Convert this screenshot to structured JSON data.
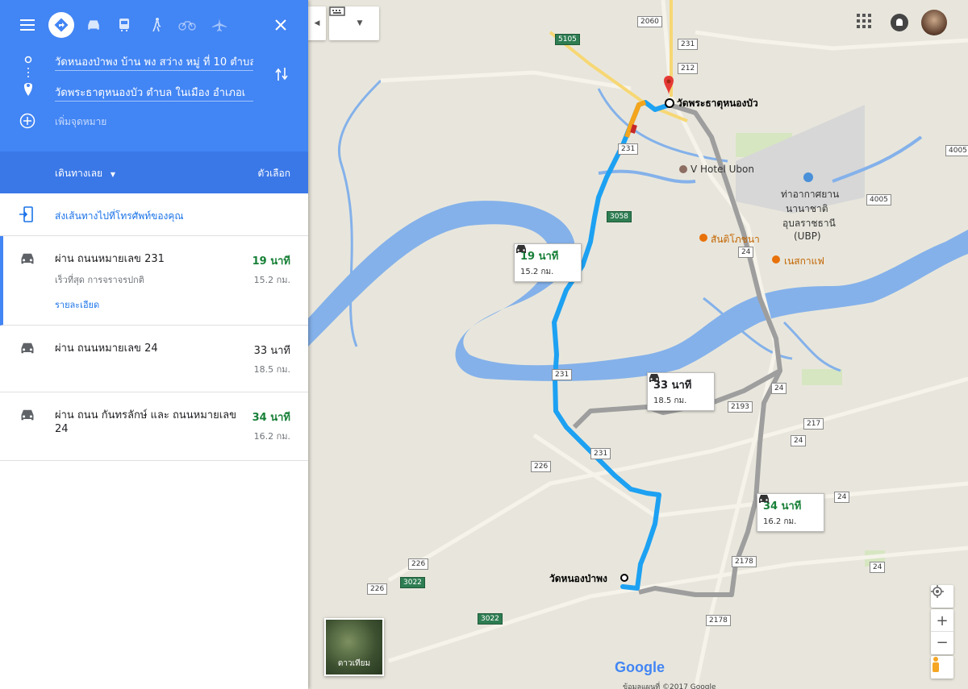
{
  "panel": {
    "origin": "วัดหนองป่าพง บ้าน พง สว่าง หมู่ ที่ 10 ตำบล",
    "destination": "วัดพระธาตุหนองบัว ตำบล ในเมือง อำเภอเ",
    "add_destination": "เพิ่มจุดหมาย",
    "depart_label": "เดินทางเลย",
    "options_label": "ตัวเลือก",
    "send_to_phone": "ส่งเส้นทางไปที่โทรศัพท์ของคุณ"
  },
  "modes": [
    "directions-icon",
    "car-icon",
    "transit-icon",
    "walk-icon",
    "bike-icon",
    "flight-icon"
  ],
  "routes": [
    {
      "via": "ผ่าน ถนนหมายเลข 231",
      "sub": "เร็วที่สุด การจราจรปกติ",
      "details": "รายละเอียด",
      "time": "19 นาที",
      "distance": "15.2 กม.",
      "time_color": "#188038"
    },
    {
      "via": "ผ่าน ถนนหมายเลข 24",
      "sub": "",
      "details": "",
      "time": "33 นาที",
      "distance": "18.5 กม.",
      "time_color": "#202124"
    },
    {
      "via": "ผ่าน ถนน กันทรลักษ์ และ ถนนหมายเลข 24",
      "sub": "",
      "details": "",
      "time": "34 นาที",
      "distance": "16.2 กม.",
      "time_color": "#188038"
    }
  ],
  "map": {
    "destination_label": "วัดพระธาตุหนองบัว",
    "origin_label": "วัดหนองป่าพง",
    "hotel": "V Hotel Ubon",
    "airport_line1": "ท่าอากาศยาน",
    "airport_line2": "นานาชาติ",
    "airport_line3": "อุบลราชธานี",
    "airport_line4": "(UBP)",
    "poi1": "สันติโภชนา",
    "poi2": "เนสกาแฟ",
    "satellite_label": "ดาวเทียม",
    "google_logo": "Google",
    "copyright": "ข้อมูลแผนที่ ©2017 Google",
    "callouts": [
      {
        "time": "19 นาที",
        "distance": "15.2 กม.",
        "time_color": "#188038"
      },
      {
        "time": "33 นาที",
        "distance": "18.5 กม.",
        "time_color": "#202124"
      },
      {
        "time": "34 นาที",
        "distance": "16.2 กม.",
        "time_color": "#188038"
      }
    ],
    "shields": [
      "2060",
      "5105",
      "231",
      "212",
      "4005",
      "3058",
      "4005",
      "24",
      "231",
      "2193",
      "217",
      "24",
      "226",
      "231",
      "24",
      "231",
      "226",
      "3022",
      "226",
      "2178",
      "3022",
      "2178",
      "24",
      "24"
    ]
  },
  "colors": {
    "primary": "#4285f4",
    "route_main": "#1da1f2",
    "route_alt": "#a0a0a0",
    "green_text": "#188038"
  }
}
